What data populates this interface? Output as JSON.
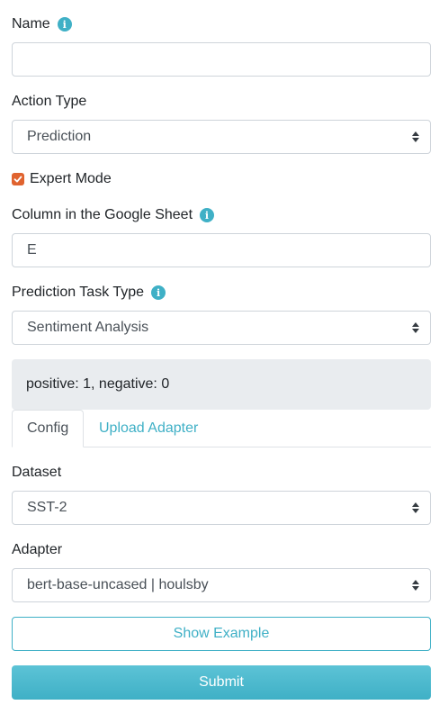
{
  "name": {
    "label": "Name",
    "value": ""
  },
  "action_type": {
    "label": "Action Type",
    "selected": "Prediction"
  },
  "expert_mode": {
    "label": "Expert Mode",
    "checked": true
  },
  "column": {
    "label": "Column in the Google Sheet",
    "value": "E"
  },
  "prediction_task_type": {
    "label": "Prediction Task Type",
    "selected": "Sentiment Analysis"
  },
  "label_mapping": "positive: 1, negative: 0",
  "tabs": [
    {
      "label": "Config",
      "active": true
    },
    {
      "label": "Upload Adapter",
      "active": false
    }
  ],
  "dataset": {
    "label": "Dataset",
    "selected": "SST-2"
  },
  "adapter": {
    "label": "Adapter",
    "selected": "bert-base-uncased | houlsby"
  },
  "buttons": {
    "show_example": "Show Example",
    "submit": "Submit"
  },
  "colors": {
    "accent": "#3fb0c6",
    "checkbox": "#e0632f",
    "info_bg": "#e9ecef",
    "border": "#ced4da"
  }
}
